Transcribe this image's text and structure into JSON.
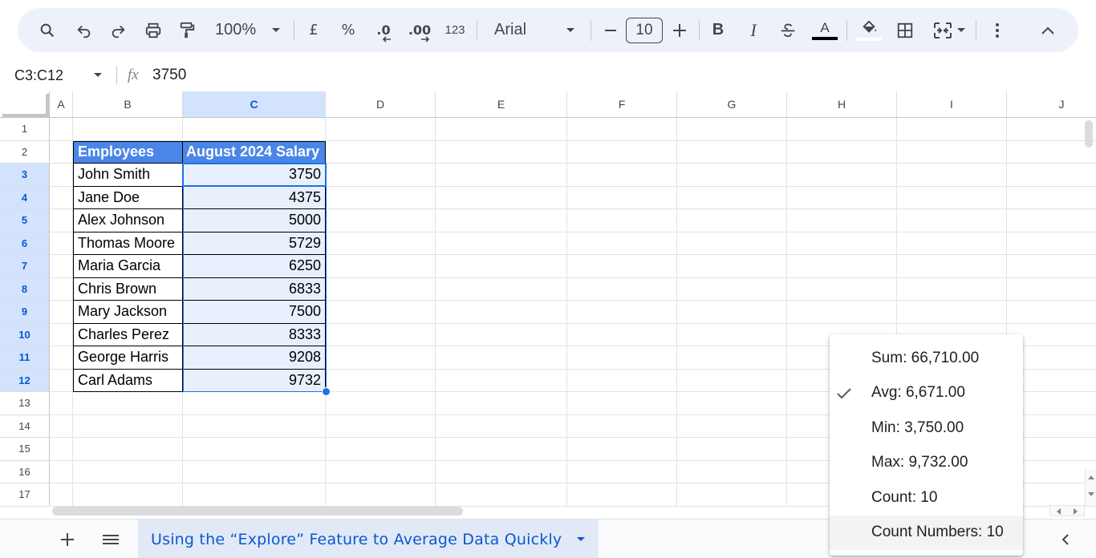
{
  "toolbar": {
    "zoom": "100%",
    "currency": "£",
    "percent": "%",
    "dec_decrease": ".0",
    "dec_increase": ".00",
    "more_formats": "123",
    "font": "Arial",
    "font_size": "10",
    "bold": "B",
    "italic": "I",
    "text_color_letter": "A"
  },
  "formula_bar": {
    "name_box": "C3:C12",
    "fx": "fx",
    "value": "3750"
  },
  "columns": [
    "A",
    "B",
    "C",
    "D",
    "E",
    "F",
    "G",
    "H",
    "I",
    "J"
  ],
  "rows": [
    "1",
    "2",
    "3",
    "4",
    "5",
    "6",
    "7",
    "8",
    "9",
    "10",
    "11",
    "12",
    "13",
    "14",
    "15",
    "16",
    "17"
  ],
  "table": {
    "headers": [
      "Employees",
      "August 2024 Salary"
    ],
    "rows": [
      {
        "name": "John Smith",
        "salary": "3750"
      },
      {
        "name": "Jane Doe",
        "salary": "4375"
      },
      {
        "name": "Alex Johnson",
        "salary": "5000"
      },
      {
        "name": "Thomas Moore",
        "salary": "5729"
      },
      {
        "name": "Maria Garcia",
        "salary": "6250"
      },
      {
        "name": "Chris Brown",
        "salary": "6833"
      },
      {
        "name": "Mary Jackson",
        "salary": "7500"
      },
      {
        "name": "Charles Perez",
        "salary": "8333"
      },
      {
        "name": "George Harris",
        "salary": "9208"
      },
      {
        "name": "Carl Adams",
        "salary": "9732"
      }
    ]
  },
  "stats_menu": {
    "items": [
      {
        "label": "Sum: 66,710.00",
        "checked": false
      },
      {
        "label": "Avg: 6,671.00",
        "checked": true
      },
      {
        "label": "Min: 3,750.00",
        "checked": false
      },
      {
        "label": "Max: 9,732.00",
        "checked": false
      },
      {
        "label": "Count: 10",
        "checked": false
      },
      {
        "label": "Count Numbers: 10",
        "checked": false
      }
    ]
  },
  "sheet_tab": {
    "name": "Using the “Explore” Feature to Average Data Quickly"
  },
  "colors": {
    "header_fill": "#4a86e8",
    "selection_fill": "#e8f0fe",
    "selection_border": "#1a73e8",
    "header_selected": "#d3e3fd",
    "toolbar_bg": "#edf2fa"
  }
}
